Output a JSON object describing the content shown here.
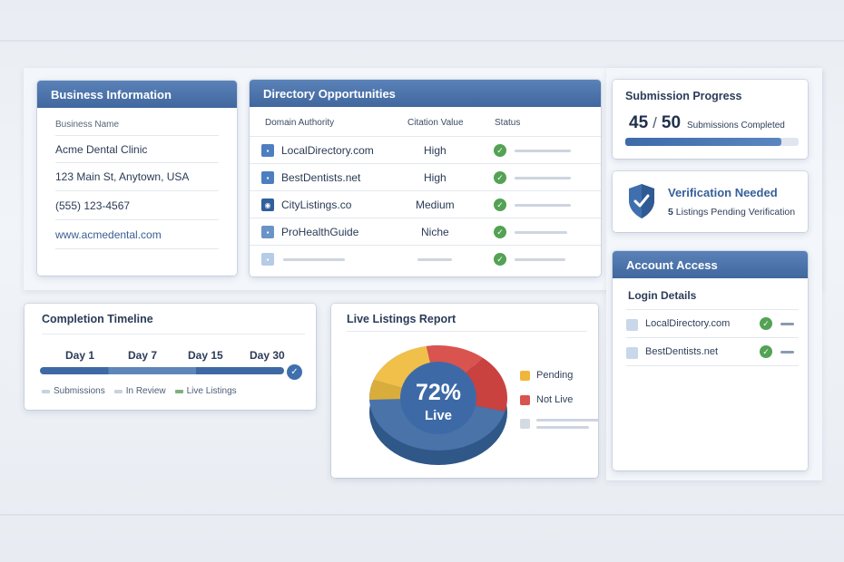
{
  "business_info": {
    "title": "Business Information",
    "name_label": "Business Name",
    "name": "Acme Dental Clinic",
    "address": "123 Main St, Anytown, USA",
    "phone": "(555) 123-4567",
    "website": "www.acmedental.com"
  },
  "directory": {
    "title": "Directory Opportunities",
    "columns": [
      "Domain Authority",
      "Citation Value",
      "Status"
    ],
    "rows": [
      {
        "name": "LocalDirectory.com",
        "value": "High"
      },
      {
        "name": "BestDentists.net",
        "value": "High"
      },
      {
        "name": "CityListings.co",
        "value": "Medium"
      },
      {
        "name": "ProHealthGuide",
        "value": "Niche"
      }
    ]
  },
  "submission": {
    "title": "Submission Progress",
    "done": "45",
    "sep": "/",
    "total": "50",
    "caption": "Submissions Completed",
    "progress": 0.9
  },
  "verification": {
    "title": "Verification Needed",
    "count": "5",
    "caption": "Listings Pending Verification"
  },
  "timeline": {
    "title": "Completion Timeline",
    "days": [
      "Day 1",
      "Day 7",
      "Day 15",
      "Day 30"
    ],
    "legend": [
      "Submissions",
      "In Review",
      "Live Listings"
    ]
  },
  "report": {
    "title": "Live Listings Report",
    "center_value": "72%",
    "center_label": "Live",
    "legend": [
      "Pending",
      "Not Live"
    ]
  },
  "account": {
    "title": "Account Access",
    "subtitle": "Login Details",
    "items": [
      "LocalDirectory.com",
      "BestDentists.net"
    ]
  },
  "colors": {
    "header": "#40679e",
    "live": "#4a73aa",
    "pending": "#f0c04a",
    "not_live": "#d9534f",
    "success": "#53a255"
  },
  "icons": {
    "check": "check-circle-icon",
    "shield": "shield-check-icon",
    "favicon": "site-favicon-icon"
  }
}
